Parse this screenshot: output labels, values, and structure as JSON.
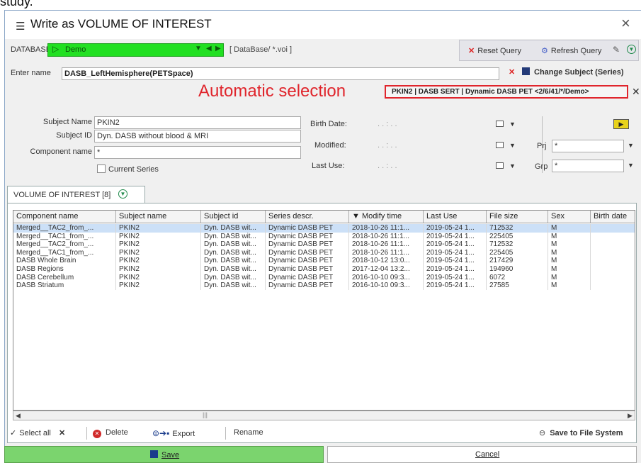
{
  "top_text": "study.",
  "window": {
    "title": "Write as VOLUME OF INTEREST",
    "close": "×"
  },
  "database": {
    "label": "DATABASE",
    "name": "Demo",
    "path": "[ DataBase/ *.voi ]",
    "reset_query": "Reset Query",
    "refresh_query": "Refresh Query"
  },
  "name_row": {
    "label": "Enter name",
    "value": "DASB_LeftHemisphere(PETSpace)",
    "change_subject": "Change Subject (Series)"
  },
  "selection": {
    "annotation": "Automatic selection",
    "value": "PKIN2 | DASB SERT | Dynamic DASB PET <2/6/41/*/Demo>"
  },
  "form": {
    "subject_name_label": "Subject Name",
    "subject_name": "PKIN2",
    "subject_id_label": "Subject ID",
    "subject_id": "Dyn. DASB without blood & MRI",
    "component_name_label": "Component name",
    "component_name": "*",
    "current_series_label": "Current Series",
    "birth_date_label": "Birth Date:",
    "modified_label": "Modified:",
    "last_use_label": "Last Use:",
    "date_placeholder": ". .   :   . .",
    "prj_label": "Prj",
    "prj_value": "*",
    "grp_label": "Grp",
    "grp_value": "*"
  },
  "tab": {
    "label": "VOLUME OF INTEREST [8]"
  },
  "table": {
    "columns": [
      "Component name",
      "Subject name",
      "Subject id",
      "Series descr.",
      "▼ Modify time",
      "Last Use",
      "File size",
      "Sex",
      "Birth date"
    ],
    "rows": [
      [
        "Merged__TAC2_from_...",
        "PKIN2",
        "Dyn. DASB wit...",
        "Dynamic DASB PET",
        "2018-10-26 11:1...",
        "2019-05-24 1...",
        "712532",
        "M",
        ""
      ],
      [
        "Merged__TAC1_from_...",
        "PKIN2",
        "Dyn. DASB wit...",
        "Dynamic DASB PET",
        "2018-10-26 11:1...",
        "2019-05-24 1...",
        "225405",
        "M",
        ""
      ],
      [
        "Merged__TAC2_from_...",
        "PKIN2",
        "Dyn. DASB wit...",
        "Dynamic DASB PET",
        "2018-10-26 11:1...",
        "2019-05-24 1...",
        "712532",
        "M",
        ""
      ],
      [
        "Merged__TAC1_from_...",
        "PKIN2",
        "Dyn. DASB wit...",
        "Dynamic DASB PET",
        "2018-10-26 11:1...",
        "2019-05-24 1...",
        "225405",
        "M",
        ""
      ],
      [
        "DASB Whole Brain",
        "PKIN2",
        "Dyn. DASB wit...",
        "Dynamic DASB PET",
        "2018-10-12 13:0...",
        "2019-05-24 1...",
        "217429",
        "M",
        ""
      ],
      [
        "DASB Regions",
        "PKIN2",
        "Dyn. DASB wit...",
        "Dynamic DASB PET",
        "2017-12-04 13:2...",
        "2019-05-24 1...",
        "194960",
        "M",
        ""
      ],
      [
        "DASB Cerebellum",
        "PKIN2",
        "Dyn. DASB wit...",
        "Dynamic DASB PET",
        "2016-10-10 09:3...",
        "2019-05-24 1...",
        "6072",
        "M",
        ""
      ],
      [
        "DASB Striatum",
        "PKIN2",
        "Dyn. DASB wit...",
        "Dynamic DASB PET",
        "2016-10-10 09:3...",
        "2019-05-24 1...",
        "27585",
        "M",
        ""
      ]
    ]
  },
  "actions": {
    "select_all": "Select all",
    "delete": "Delete",
    "export": "Export",
    "rename": "Rename",
    "save_fs": "Save to File System"
  },
  "buttons": {
    "save": "Save",
    "cancel": "Cancel"
  },
  "colors": {
    "db_green": "#22e022",
    "annotation_red": "#e0252c",
    "save_green": "#7bd46e",
    "selected_row": "#cce0f7"
  }
}
